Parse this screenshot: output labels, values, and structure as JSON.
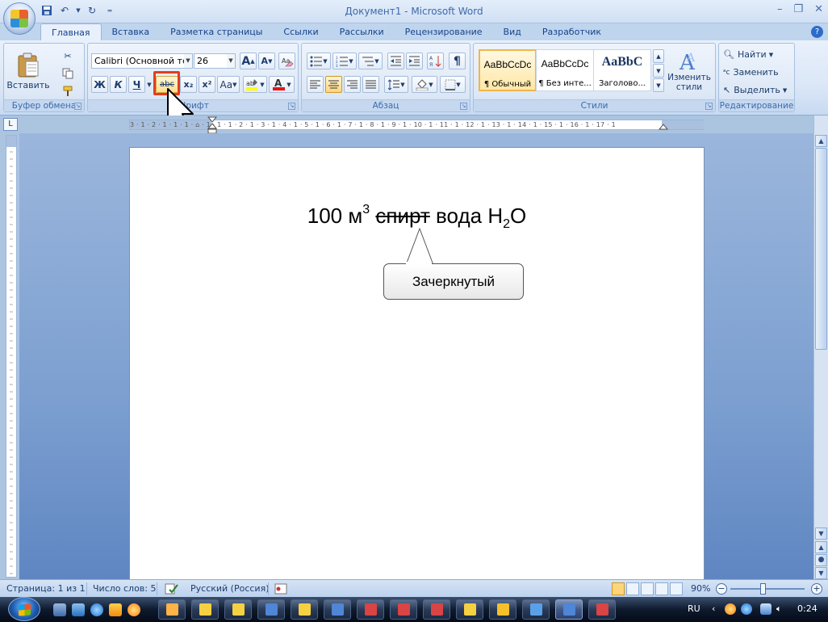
{
  "window": {
    "title": "Документ1 - Microsoft Word",
    "qat": [
      "save-icon",
      "undo-icon",
      "redo-icon",
      "customize-icon"
    ]
  },
  "tabs": [
    "Главная",
    "Вставка",
    "Разметка страницы",
    "Ссылки",
    "Рассылки",
    "Рецензирование",
    "Вид",
    "Разработчик"
  ],
  "active_tab": "Главная",
  "ribbon": {
    "clipboard": {
      "label": "Буфер обмена",
      "paste_label": "Вставить"
    },
    "font": {
      "label": "Шрифт",
      "font_name": "Calibri (Основной те",
      "font_size": "26",
      "bold": "Ж",
      "italic": "К",
      "underline": "Ч",
      "strikethrough": "abc",
      "subscript": "x₂",
      "superscript": "x²",
      "change_case": "Aa",
      "grow": "A",
      "shrink": "A"
    },
    "paragraph": {
      "label": "Абзац",
      "pilcrow": "¶"
    },
    "styles": {
      "label": "Стили",
      "items": [
        {
          "preview": "AaBbCcDc",
          "name": "¶ Обычный"
        },
        {
          "preview": "AaBbCcDc",
          "name": "¶ Без инте..."
        },
        {
          "preview": "AaBbC",
          "name": "Заголово..."
        }
      ],
      "change_styles": "Изменить стили"
    },
    "editing": {
      "label": "Редактирование",
      "find": "Найти",
      "replace": "Заменить",
      "select": "Выделить"
    }
  },
  "ruler": {
    "labels": "3 · 1 · 2 · 1 · 1 · 1 · ⌂ · 1 · 1 · 1 · 2 · 1 · 3 · 1 · 4 · 1 · 5 · 1 · 6 · 1 · 7 · 1 · 8 · 1 · 9 · 1 · 10 · 1 · 11 · 1 · 12 · 1 · 13 · 1 · 14 · 1 · 15 · 1 · 16 · 1 · 17 · 1"
  },
  "document": {
    "number": "100",
    "unit": "м",
    "exponent": "3",
    "struck_word": "спирт",
    "word": "вода",
    "formula_h": "Н",
    "formula_sub": "2",
    "formula_o": "O",
    "callout": "Зачеркнутый"
  },
  "status": {
    "page": "Страница: 1 из 1",
    "words": "Число слов: 5",
    "language": "Русский (Россия)",
    "zoom": "90%",
    "zoom_level_percent": 90
  },
  "taskbar": {
    "lang": "RU",
    "time": "0:24"
  },
  "colors": {
    "highlight_box": "#e43c1f",
    "font_color_bar": "#e8141a",
    "highlight_color_bar": "#ffff00"
  }
}
